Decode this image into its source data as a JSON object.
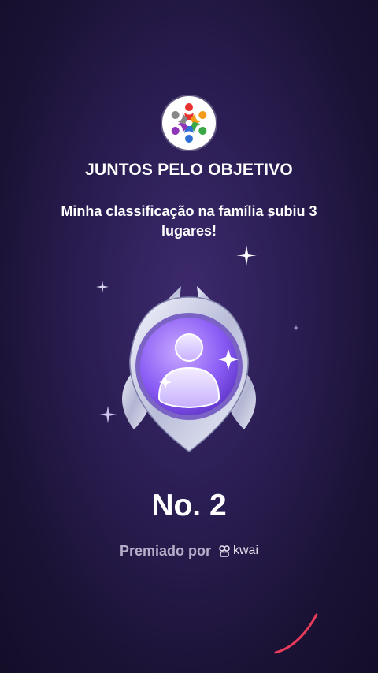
{
  "header": {
    "logo_icon": "people-circle-logo",
    "title": "JUNTOS PELO OBJETIVO",
    "message": "Minha classificação na família subiu 3 lugares!"
  },
  "badge": {
    "icon": "person-medal-icon"
  },
  "rank": {
    "label": "No. 2"
  },
  "footer": {
    "awarded_by": "Premiado por",
    "brand": "kwai"
  },
  "colors": {
    "background": "#2a1d52",
    "accent_purple": "#8a5cf5",
    "silver": "#d9dcef"
  }
}
